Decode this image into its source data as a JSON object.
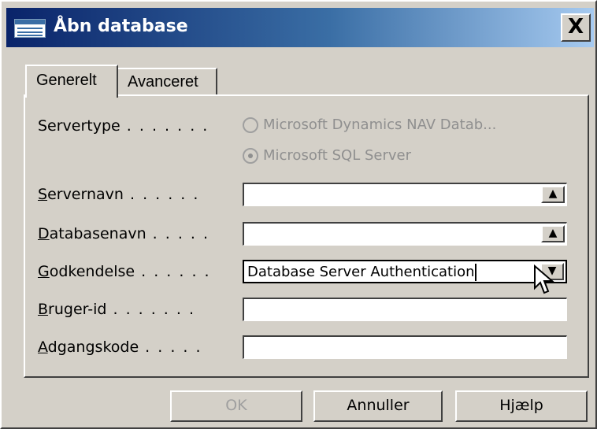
{
  "window": {
    "title": "Åbn database",
    "icon": "database-table-icon",
    "close_label": "X"
  },
  "tabs": [
    {
      "label": "Generelt",
      "active": true
    },
    {
      "label": "Avanceret",
      "active": false
    }
  ],
  "form": {
    "servertype": {
      "label": "Servertype",
      "options": [
        {
          "label": "Microsoft Dynamics NAV Datab...",
          "selected": false,
          "enabled": false
        },
        {
          "label": "Microsoft SQL Server",
          "selected": true,
          "enabled": false
        }
      ]
    },
    "servername": {
      "label": "Servernavn",
      "value": "",
      "button_icon": "lookup-up-arrow-icon"
    },
    "databasename": {
      "label": "Databasenavn",
      "value": "",
      "button_icon": "lookup-up-arrow-icon"
    },
    "authentication": {
      "label": "Godkendelse",
      "value": "Database Server Authentication",
      "button_icon": "dropdown-arrow-icon"
    },
    "userid": {
      "label": "Bruger-id",
      "value": ""
    },
    "password": {
      "label": "Adgangskode",
      "value": ""
    }
  },
  "buttons": {
    "ok": "OK",
    "cancel": "Annuller",
    "help": "Hjælp"
  },
  "colors": {
    "face": "#d4d0c8",
    "title_start": "#0a246a",
    "title_end": "#a6caf0"
  }
}
